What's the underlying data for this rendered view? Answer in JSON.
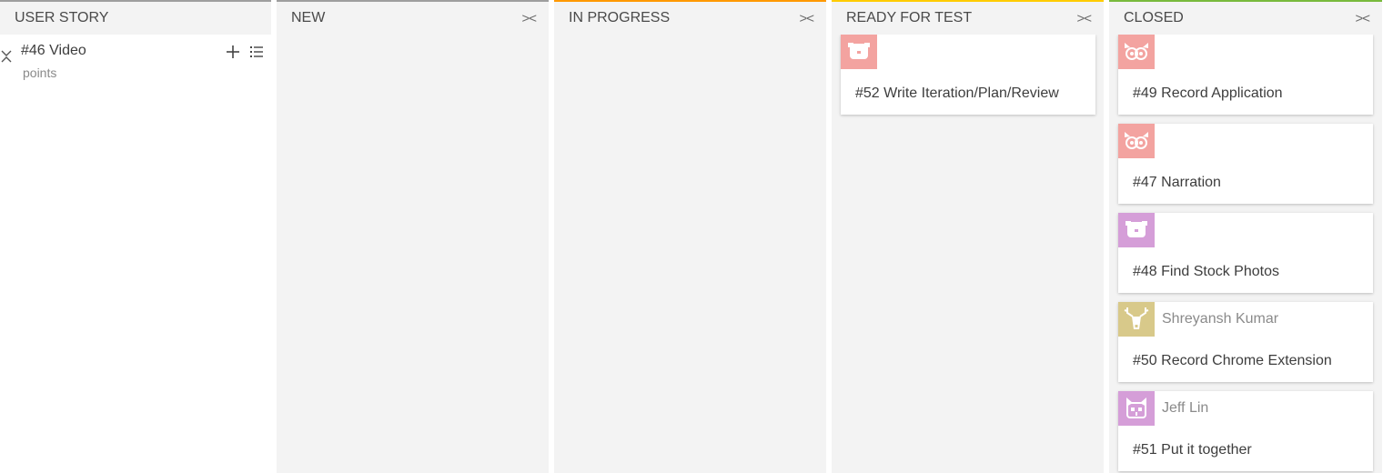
{
  "columns": {
    "user_story": {
      "title": "USER STORY",
      "top_color": "#9e9e9e"
    },
    "new": {
      "title": "NEW",
      "top_color": "#9e9e9e",
      "collapse": "><"
    },
    "in_progress": {
      "title": "IN PROGRESS",
      "top_color": "#ff9900",
      "collapse": "><"
    },
    "ready_for_test": {
      "title": "READY FOR TEST",
      "top_color": "#ffcc00",
      "collapse": "><"
    },
    "closed": {
      "title": "CLOSED",
      "top_color": "#78ba3c",
      "collapse": "><"
    }
  },
  "story": {
    "title": "#46 Video",
    "points": "points"
  },
  "ready_for_test_cards": [
    {
      "task": "#52 Write Iteration/Plan/Review",
      "assignee": "",
      "avatar_color": "#f3a3a0",
      "avatar_icon": "bear-face-icon"
    }
  ],
  "closed_cards": [
    {
      "task": "#49 Record Application",
      "assignee": "",
      "avatar_color": "#f3a3a0",
      "avatar_icon": "owl-face-icon"
    },
    {
      "task": "#47 Narration",
      "assignee": "",
      "avatar_color": "#f3a3a0",
      "avatar_icon": "owl-face-icon"
    },
    {
      "task": "#48 Find Stock Photos",
      "assignee": "",
      "avatar_color": "#d59ed8",
      "avatar_icon": "bear-face-icon"
    },
    {
      "task": "#50 Record Chrome Extension",
      "assignee": "Shreyansh Kumar",
      "avatar_color": "#d8c98a",
      "avatar_icon": "deer-face-icon"
    },
    {
      "task": "#51 Put it together",
      "assignee": "Jeff Lin",
      "avatar_color": "#d59ed8",
      "avatar_icon": "cat-face-icon"
    }
  ]
}
